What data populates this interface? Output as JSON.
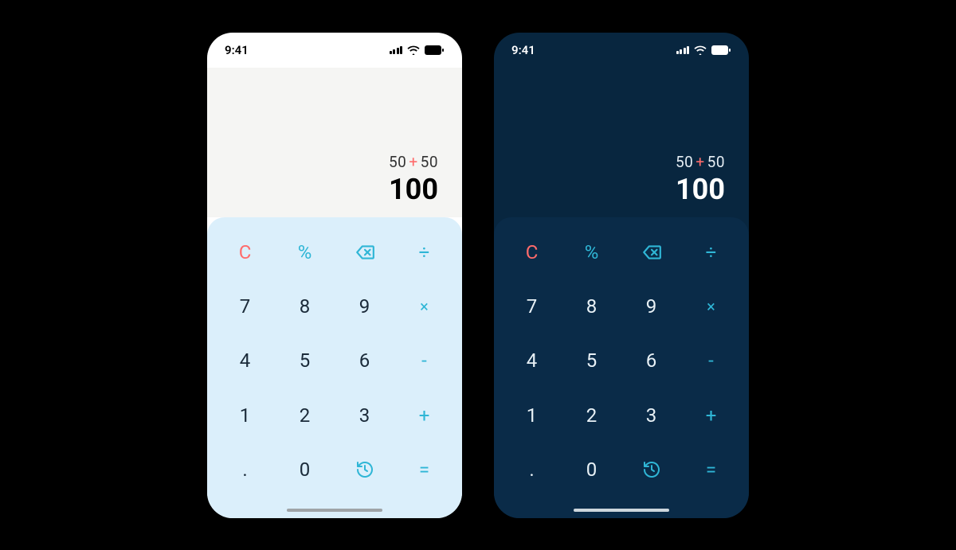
{
  "status": {
    "time": "9:41"
  },
  "calc": {
    "expr_a": "50",
    "expr_op": "+",
    "expr_b": "50",
    "result": "100"
  },
  "keys": {
    "clear": "C",
    "percent": "%",
    "divide": "÷",
    "multiply": "×",
    "minus": "-",
    "plus": "+",
    "equals": "=",
    "dot": ".",
    "d7": "7",
    "d8": "8",
    "d9": "9",
    "d4": "4",
    "d5": "5",
    "d6": "6",
    "d1": "1",
    "d2": "2",
    "d3": "3",
    "d0": "0"
  }
}
